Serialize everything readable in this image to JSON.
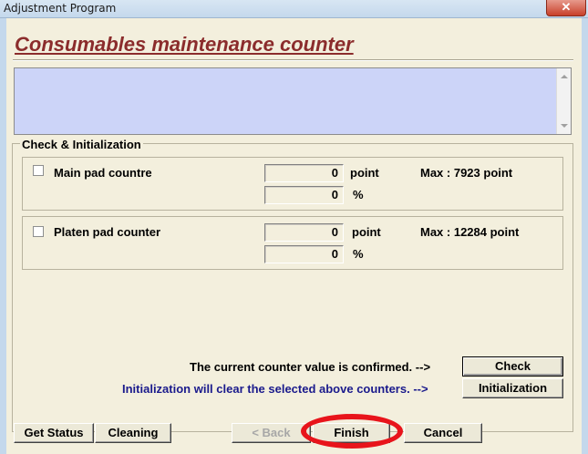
{
  "window": {
    "title": "Adjustment Program",
    "close_glyph": "✕"
  },
  "header": {
    "title": "Consumables maintenance counter"
  },
  "info_box": {
    "text": ""
  },
  "group": {
    "label": "Check & Initialization",
    "counters": [
      {
        "checked": false,
        "label": "Main pad countre",
        "point_value": "0",
        "point_unit": "point",
        "percent_value": "0",
        "percent_unit": "%",
        "max_text": "Max : 7923 point"
      },
      {
        "checked": false,
        "label": "Platen pad counter",
        "point_value": "0",
        "point_unit": "point",
        "percent_value": "0",
        "percent_unit": "%",
        "max_text": "Max : 12284 point"
      }
    ],
    "check_hint": "The current counter value is confirmed. -->",
    "init_hint": "Initialization will clear the selected above counters. -->",
    "check_button": "Check",
    "init_button": "Initialization"
  },
  "footer": {
    "get_status": "Get Status",
    "cleaning": "Cleaning",
    "back": "< Back",
    "finish": "Finish",
    "cancel": "Cancel"
  },
  "colors": {
    "title": "#8b2c2c",
    "panel_bg": "#f3efdd",
    "info_bg": "#ccd4f8",
    "init_hint": "#1a1a8c",
    "annotation": "#e8141b"
  }
}
